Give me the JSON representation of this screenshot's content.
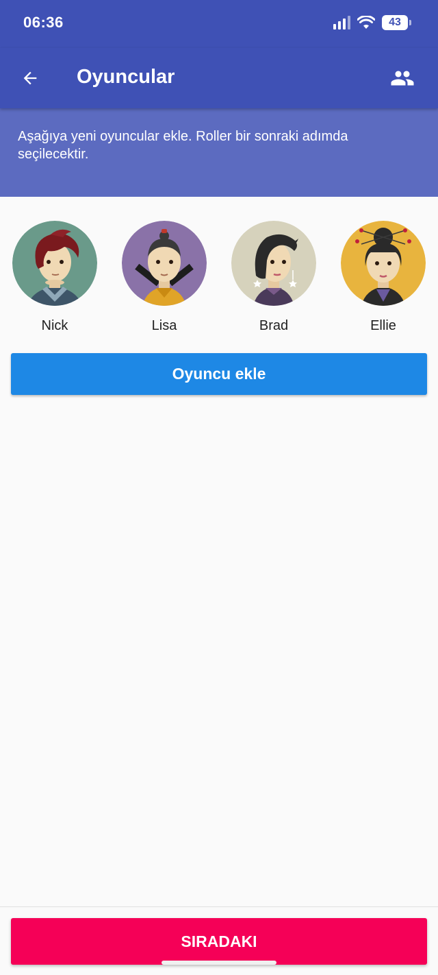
{
  "status_bar": {
    "time": "06:36",
    "battery": "43",
    "icons": [
      "signal-icon",
      "wifi-icon",
      "battery-icon"
    ]
  },
  "app_bar": {
    "title": "Oyuncular",
    "back_icon": "arrow-back-icon",
    "action_icon": "people-icon"
  },
  "info_banner": {
    "text": "Aşağıya yeni oyuncular ekle. Roller bir sonraki adımda seçilecektir."
  },
  "players": [
    {
      "name": "Nick",
      "avatar_bg": "#6a9a8a"
    },
    {
      "name": "Lisa",
      "avatar_bg": "#8a72a8"
    },
    {
      "name": "Brad",
      "avatar_bg": "#d6d2bc"
    },
    {
      "name": "Ellie",
      "avatar_bg": "#e8b43e"
    }
  ],
  "buttons": {
    "add_player": "Oyuncu ekle",
    "next": "SIRADAKI"
  },
  "colors": {
    "primary": "#3f51b5",
    "banner": "#5c6bc0",
    "add_button": "#1e88e5",
    "next_button": "#f50057"
  }
}
